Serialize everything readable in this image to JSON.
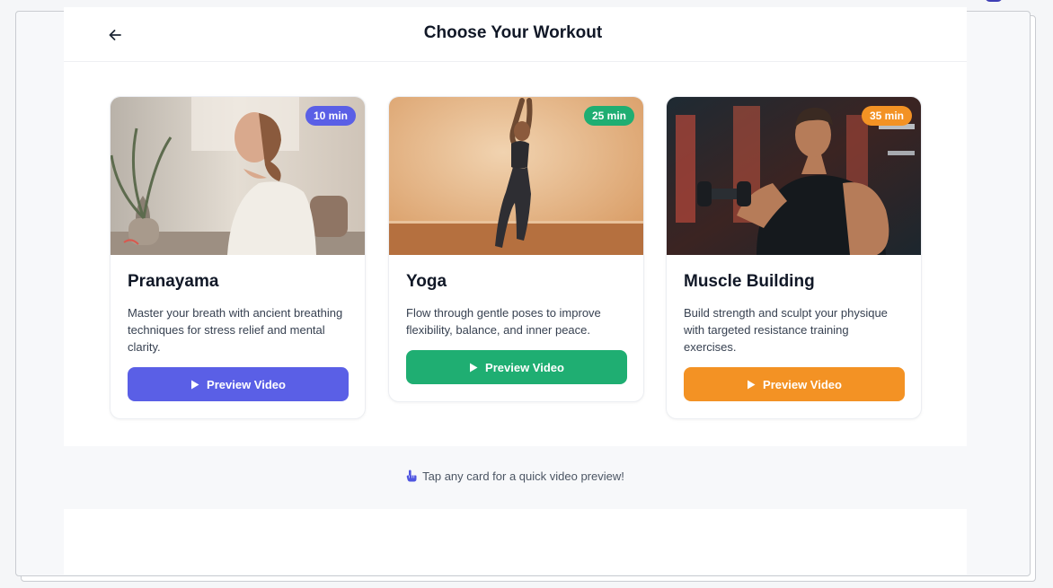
{
  "header": {
    "title": "Choose Your Workout",
    "back_icon": "arrow-left-icon"
  },
  "cards": [
    {
      "title": "Pranayama",
      "duration": "10 min",
      "description": "Master your breath with ancient breathing techniques for stress relief and mental clarity.",
      "button_label": "Preview Video",
      "accent_color": "#5a5fe6",
      "image": "woman-meditating-photo"
    },
    {
      "title": "Yoga",
      "duration": "25 min",
      "description": "Flow through gentle poses to improve flexibility, balance, and inner peace.",
      "button_label": "Preview Video",
      "accent_color": "#1fae72",
      "image": "woman-yoga-pose-photo"
    },
    {
      "title": "Muscle Building",
      "duration": "35 min",
      "description": "Build strength and sculpt your physique with targeted resistance training exercises.",
      "button_label": "Preview Video",
      "accent_color": "#f39224",
      "image": "man-lifting-dumbbell-photo"
    }
  ],
  "tip": {
    "text": "Tap any card for a quick video preview!",
    "icon": "pointing-hand-icon"
  },
  "colors": {
    "page_bg": "#f7f8fa",
    "title": "#111827",
    "text": "#374151"
  }
}
